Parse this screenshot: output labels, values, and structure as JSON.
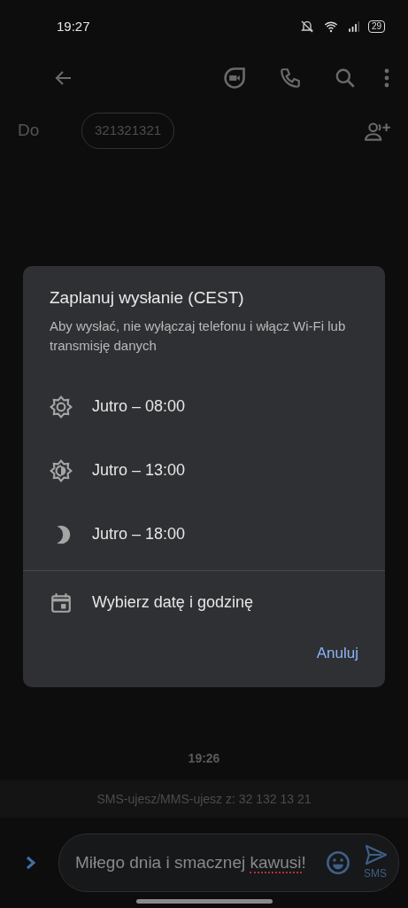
{
  "status_bar": {
    "time": "19:27",
    "battery": "29"
  },
  "recipient": {
    "label": "Do",
    "chip": "321321321"
  },
  "dialog": {
    "title": "Zaplanuj wysłanie (CEST)",
    "subtitle": "Aby wysłać, nie wyłączaj telefonu i włącz Wi-Fi lub transmisję danych",
    "options": [
      {
        "kind": "sun",
        "label": "Jutro – 08:00"
      },
      {
        "kind": "half-sun",
        "label": "Jutro – 13:00"
      },
      {
        "kind": "moon",
        "label": "Jutro – 18:00"
      }
    ],
    "pick_date": {
      "label": "Wybierz datę i godzinę"
    },
    "cancel": "Anuluj"
  },
  "timestamp": "19:26",
  "banner": "SMS-ujesz/MMS-ujesz z: 32 132 13 21",
  "composer": {
    "value_parts": [
      {
        "text": "Miłego dnia i smacznej ",
        "misspelled": false
      },
      {
        "text": "kawusi",
        "misspelled": true
      },
      {
        "text": "!",
        "misspelled": false
      }
    ],
    "send_label": "SMS"
  }
}
